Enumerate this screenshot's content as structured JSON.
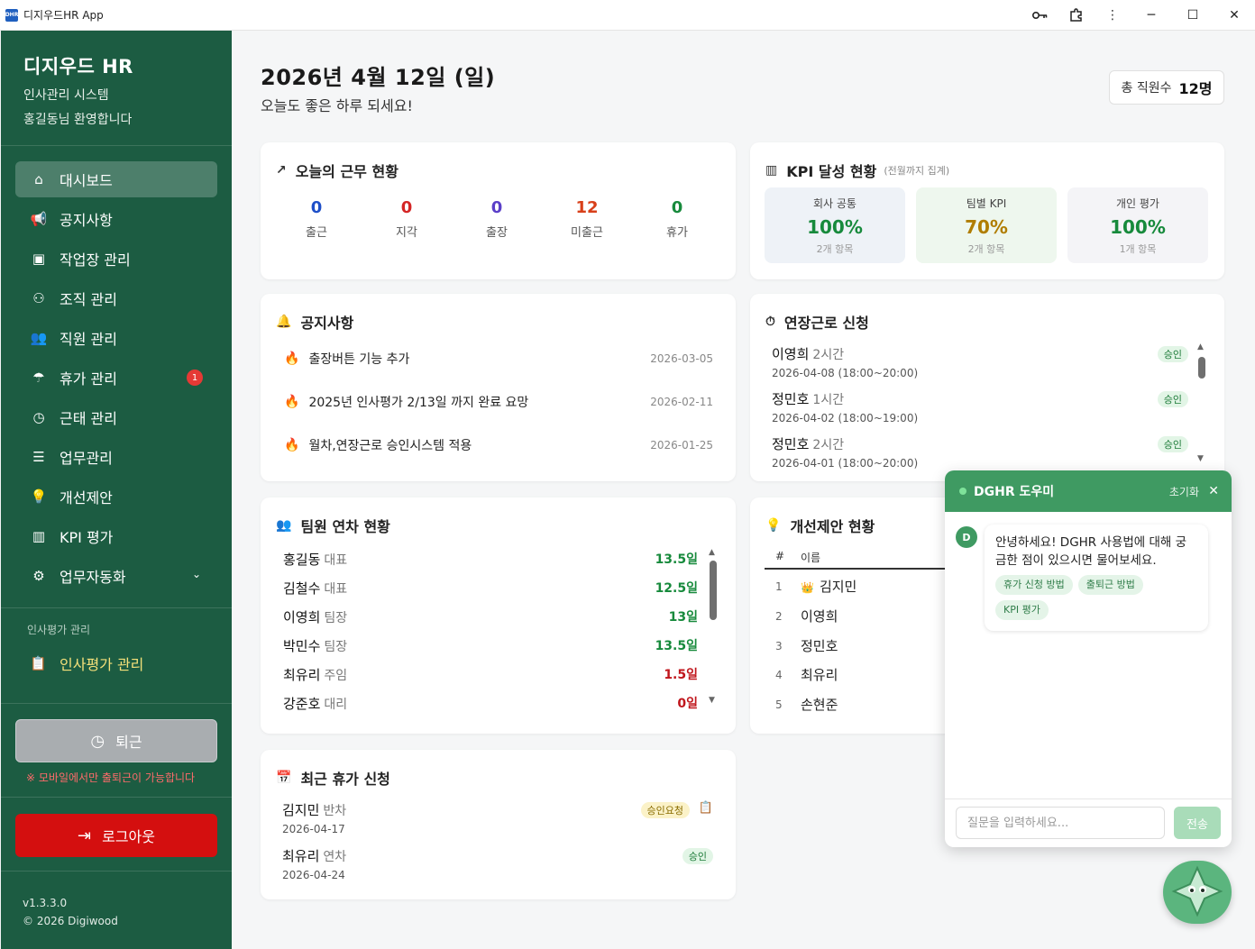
{
  "window": {
    "title": "디지우드HR App",
    "icon": "DHR"
  },
  "titlebar_icons": [
    "key-icon",
    "extension-icon",
    "more-icon"
  ],
  "sidebar": {
    "brand_title": "디지우드 HR",
    "brand_sub": "인사관리 시스템",
    "brand_user": "홍길동님 환영합니다",
    "items": [
      {
        "label": "대시보드",
        "icon": "⌂",
        "active": true
      },
      {
        "label": "공지사항",
        "icon": "📢"
      },
      {
        "label": "작업장 관리",
        "icon": "▣"
      },
      {
        "label": "조직 관리",
        "icon": "⚇"
      },
      {
        "label": "직원 관리",
        "icon": "👥"
      },
      {
        "label": "휴가 관리",
        "icon": "☂",
        "badge": "1"
      },
      {
        "label": "근태 관리",
        "icon": "◷"
      },
      {
        "label": "업무관리",
        "icon": "☰"
      },
      {
        "label": "개선제안",
        "icon": "💡"
      },
      {
        "label": "KPI 평가",
        "icon": "▥"
      },
      {
        "label": "업무자동화",
        "icon": "⚙",
        "chevron": "⌄"
      }
    ],
    "section_label": "인사평가 관리",
    "eval_item": "인사평가 관리",
    "clockout_label": "퇴근",
    "clockout_warning": "※ 모바일에서만 출퇴근이 가능합니다",
    "logout_label": "로그아웃",
    "version": "v1.3.3.0",
    "copyright": "© 2026 Digiwood"
  },
  "header": {
    "date": "2026년 4월 12일 (일)",
    "greeting": "오늘도 좋은 하루 되세요!",
    "employee_count_label": "총 직원수",
    "employee_count_value": "12명"
  },
  "work_status": {
    "title": "오늘의 근무 현황",
    "items": [
      {
        "value": "0",
        "label": "출근",
        "color": "#1e4fc8"
      },
      {
        "value": "0",
        "label": "지각",
        "color": "#d42525"
      },
      {
        "value": "0",
        "label": "출장",
        "color": "#5a3fc8"
      },
      {
        "value": "12",
        "label": "미출근",
        "color": "#d8401a"
      },
      {
        "value": "0",
        "label": "휴가",
        "color": "#178a3c"
      }
    ]
  },
  "kpi": {
    "title": "KPI 달성 현황",
    "subtitle": "(전월까지 집계)",
    "boxes": [
      {
        "title": "회사 공통",
        "value": "100%",
        "count": "2개 항목",
        "bg": "#eef2f7",
        "color": "#178a3c"
      },
      {
        "title": "팀별 KPI",
        "value": "70%",
        "count": "2개 항목",
        "bg": "#eef7ee",
        "color": "#b07d00"
      },
      {
        "title": "개인 평가",
        "value": "100%",
        "count": "1개 항목",
        "bg": "#f4f4f7",
        "color": "#178a3c"
      }
    ]
  },
  "notices": {
    "title": "공지사항",
    "items": [
      {
        "text": "출장버튼 기능 추가",
        "date": "2026-03-05"
      },
      {
        "text": "2025년 인사평가 2/13일 까지 완료 요망",
        "date": "2026-02-11"
      },
      {
        "text": "월차,연장근로 승인시스템 적용",
        "date": "2026-01-25"
      }
    ]
  },
  "overtime": {
    "title": "연장근로 신청",
    "items": [
      {
        "name": "이영희",
        "hours": "2시간",
        "date": "2026-04-08 (18:00~20:00)",
        "status": "승인"
      },
      {
        "name": "정민호",
        "hours": "1시간",
        "date": "2026-04-02 (18:00~19:00)",
        "status": "승인"
      },
      {
        "name": "정민호",
        "hours": "2시간",
        "date": "2026-04-01 (18:00~20:00)",
        "status": "승인"
      }
    ]
  },
  "team_leave": {
    "title": "팀원 연차 현황",
    "items": [
      {
        "name": "홍길동",
        "position": "대표",
        "days": "13.5일",
        "color": "#178a3c"
      },
      {
        "name": "김철수",
        "position": "대표",
        "days": "12.5일",
        "color": "#178a3c"
      },
      {
        "name": "이영희",
        "position": "팀장",
        "days": "13일",
        "color": "#178a3c"
      },
      {
        "name": "박민수",
        "position": "팀장",
        "days": "13.5일",
        "color": "#178a3c"
      },
      {
        "name": "최유리",
        "position": "주임",
        "days": "1.5일",
        "color": "#c0161c"
      },
      {
        "name": "강준호",
        "position": "대리",
        "days": "0일",
        "color": "#c0161c"
      }
    ]
  },
  "suggestions": {
    "title": "개선제안 현황",
    "col_num": "#",
    "col_name": "이름",
    "items": [
      {
        "num": "1",
        "name": "김지민",
        "crown": "👑"
      },
      {
        "num": "2",
        "name": "이영희"
      },
      {
        "num": "3",
        "name": "정민호"
      },
      {
        "num": "4",
        "name": "최유리"
      },
      {
        "num": "5",
        "name": "손현준"
      }
    ]
  },
  "recent_leave": {
    "title": "최근 휴가 신청",
    "items": [
      {
        "name": "김지민",
        "type": "반차",
        "date": "2026-04-17",
        "status": "승인요청",
        "status_kind": "pend",
        "has_action": true
      },
      {
        "name": "최유리",
        "type": "연차",
        "date": "2026-04-24",
        "status": "승인",
        "status_kind": "ok"
      }
    ]
  },
  "chat": {
    "title": "DGHR 도우미",
    "reset_label": "초기화",
    "avatar": "D",
    "message": "안녕하세요! DGHR 사용법에 대해 궁금한 점이 있으시면 물어보세요.",
    "chips": [
      "휴가 신청 방법",
      "출퇴근 방법",
      "KPI 평가"
    ],
    "input_placeholder": "질문을 입력하세요...",
    "send_label": "전송"
  }
}
